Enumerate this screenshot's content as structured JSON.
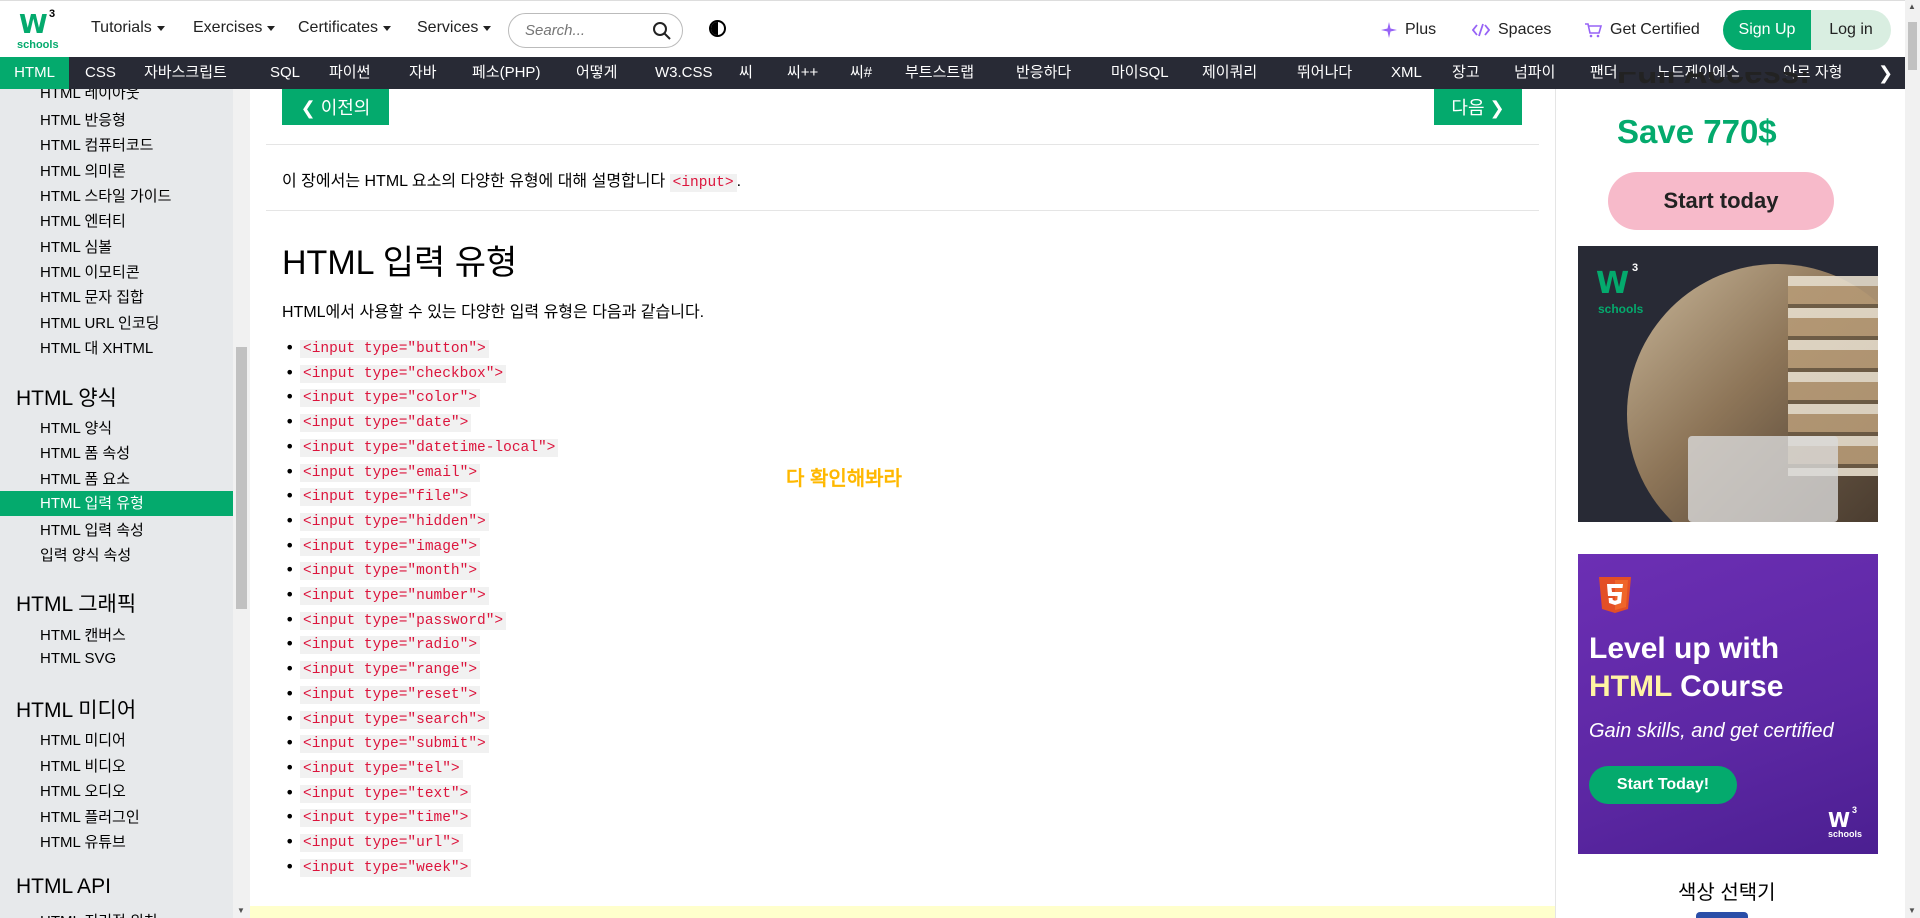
{
  "topnav": {
    "logo": {
      "mark": "W",
      "sup": "3",
      "word": "schools"
    },
    "menu": [
      {
        "label": "Tutorials"
      },
      {
        "label": "Exercises"
      },
      {
        "label": "Certificates"
      },
      {
        "label": "Services"
      }
    ],
    "search_placeholder": "Search...",
    "right_links": [
      {
        "label": "Plus",
        "icon": "sparkle-icon"
      },
      {
        "label": "Spaces",
        "icon": "code-icon"
      },
      {
        "label": "Get Certified",
        "icon": "cart-icon"
      }
    ],
    "signup": "Sign Up",
    "login": "Log in"
  },
  "langbar": [
    "HTML",
    "CSS",
    "자바스크립트",
    "SQL",
    "파이썬",
    "자바",
    "페소(PHP)",
    "어떻게",
    "W3.CSS",
    "씨",
    "씨++",
    "씨#",
    "부트스트랩",
    "반응하다",
    "마이SQL",
    "제이쿼리",
    "뛰어나다",
    "XML",
    "장고",
    "넘파이",
    "팬더",
    "노드제이에스",
    "아르 자형"
  ],
  "sidebar": {
    "group1": [
      "HTML 레이아웃",
      "HTML 반응형",
      "HTML 컴퓨터코드",
      "HTML 의미론",
      "HTML 스타일 가이드",
      "HTML 엔터티",
      "HTML 심볼",
      "HTML 이모티콘",
      "HTML 문자 집합",
      "HTML URL 인코딩",
      "HTML 대 XHTML"
    ],
    "head_forms": "HTML 양식",
    "group2": [
      "HTML 양식",
      "HTML 폼 속성",
      "HTML 폼 요소",
      "HTML 입력 유형",
      "HTML 입력 속성",
      "입력 양식 속성"
    ],
    "head_graphics": "HTML 그래픽",
    "group3": [
      "HTML 캔버스",
      "HTML SVG"
    ],
    "head_media": "HTML 미디어",
    "group4": [
      "HTML 미디어",
      "HTML 비디오",
      "HTML 오디오",
      "HTML 플러그인",
      "HTML 유튜브"
    ],
    "head_api": "HTML API",
    "group5": [
      "HTML 지리적 위치"
    ]
  },
  "main": {
    "prev": "❮ 이전의",
    "next": "다음 ❯",
    "intro_before": "이 장에서는 HTML 요소의 다양한 유형에 대해 설명합니다 ",
    "intro_code": "<input>",
    "intro_after": ".",
    "heading": "HTML 입력 유형",
    "lead": "HTML에서 사용할 수 있는 다양한 입력 유형은 다음과 같습니다.",
    "types": [
      "<input type=\"button\">",
      "<input type=\"checkbox\">",
      "<input type=\"color\">",
      "<input type=\"date\">",
      "<input type=\"datetime-local\">",
      "<input type=\"email\">",
      "<input type=\"file\">",
      "<input type=\"hidden\">",
      "<input type=\"image\">",
      "<input type=\"month\">",
      "<input type=\"number\">",
      "<input type=\"password\">",
      "<input type=\"radio\">",
      "<input type=\"range\">",
      "<input type=\"reset\">",
      "<input type=\"search\">",
      "<input type=\"submit\">",
      "<input type=\"tel\">",
      "<input type=\"text\">",
      "<input type=\"time\">",
      "<input type=\"url\">",
      "<input type=\"week\">"
    ],
    "overlay": "다 확인해봐라"
  },
  "ads": {
    "top_cut": "Full Access!",
    "save": "Save 770$",
    "start_today": "Start today",
    "photo_logo": {
      "mark": "W",
      "sup": "3",
      "word": "schools"
    },
    "course": {
      "title1": "Level up with",
      "title2_hl": "HTML",
      "title2_rest": " Course",
      "sub": "Gain skills, and get certified",
      "btn": "Start Today!",
      "logo": {
        "mark": "W",
        "sup": "3",
        "word": "schools"
      }
    },
    "color_picker": "색상 선택기"
  },
  "colors": {
    "brand": "#04AA6D",
    "dark": "#282A35",
    "code": "#DC143C",
    "overlay": "#FFB800"
  }
}
